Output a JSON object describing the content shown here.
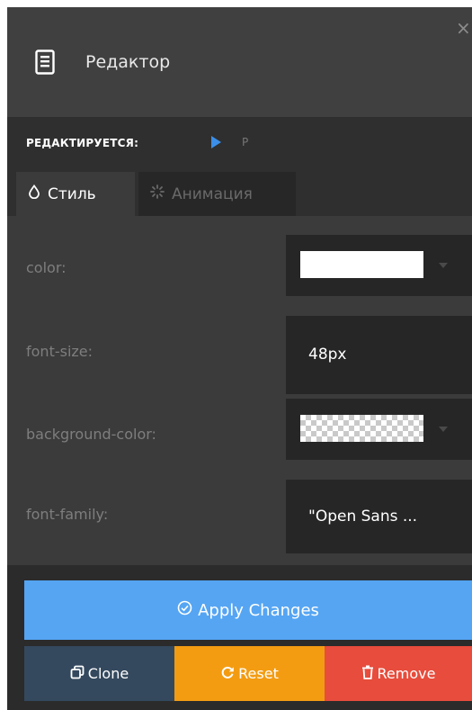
{
  "header": {
    "icon": "document-icon",
    "title": "Редактор",
    "close_icon": "close-icon",
    "close_glyph": "×"
  },
  "editing": {
    "label": "РЕДАКТИРУЕТСЯ:",
    "icon": "play-icon",
    "target": "P",
    "accent_color": "#3b8fe8"
  },
  "tabs": [
    {
      "label": "Стиль",
      "icon": "drop-icon",
      "glyph": "◯",
      "active": true
    },
    {
      "label": "Анимация",
      "icon": "sparkle-icon",
      "glyph": "҉",
      "active": false
    }
  ],
  "properties": [
    {
      "label": "color:",
      "type": "color",
      "value": "#ffffff"
    },
    {
      "label": "font-size:",
      "type": "text",
      "value": "48px"
    },
    {
      "label": "background-color:",
      "type": "color",
      "value": "transparent"
    },
    {
      "label": "font-family:",
      "type": "text",
      "value": "\"Open Sans ..."
    }
  ],
  "footer": {
    "apply": {
      "label": "Apply Changes",
      "icon": "check-circle-icon",
      "glyph": "⊙",
      "color": "#55a5f3"
    },
    "clone": {
      "label": "Clone",
      "icon": "clone-icon",
      "glyph": "⧉",
      "color": "#34495e"
    },
    "reset": {
      "label": "Reset",
      "icon": "refresh-icon",
      "glyph": "↻",
      "color": "#f39c12"
    },
    "remove": {
      "label": "Remove",
      "icon": "trash-icon",
      "glyph": "🗑",
      "color": "#e74c3c"
    }
  }
}
